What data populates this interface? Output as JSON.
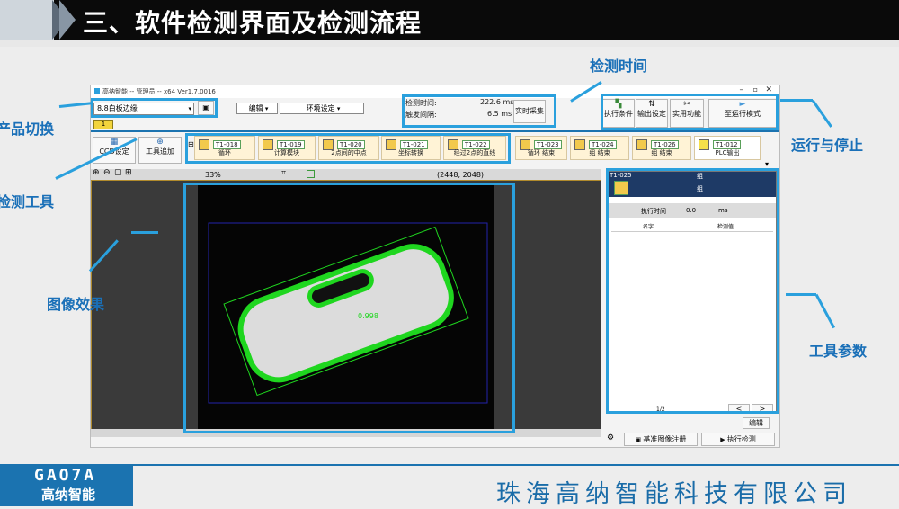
{
  "slide": {
    "title": "三、软件检测界面及检测流程",
    "company": "珠海高纳智能科技有限公司",
    "logo_text": "GAO7A",
    "logo_sub": "高纳智能"
  },
  "annotations": {
    "product_switch": "产品切换",
    "detection_tool": "检测工具",
    "image_effect": "图像效果",
    "detection_time": "检测时间",
    "run_stop": "运行与停止",
    "tool_params": "工具参数"
  },
  "app": {
    "window_title": "高纳智能 -- 管理员 -- x64 Ver1.7.0016",
    "product_select": "8.8白板边缘",
    "tab_number": "1",
    "edit_menu": "编辑",
    "env_menu": "环境设定",
    "detect_time_label": "检测时间:",
    "detect_time_value": "222.6 ms",
    "trigger_interval_label": "触发间隔:",
    "trigger_interval_value": "6.5 ms",
    "realtime_btn": "实时采集",
    "exec_cond_btn": "执行条件",
    "output_btn": "输出设定",
    "utility_btn": "实用功能",
    "run_mode_btn": "至运行模式",
    "ccd_btn": "CCD设定",
    "add_tool_btn": "工具追加",
    "zoom_value": "33%",
    "image_size": "(2448, 2048)",
    "measure_value": "0.998",
    "tools": [
      {
        "id": "T1-018",
        "label": "循环"
      },
      {
        "id": "T1-019",
        "label": "计算模块"
      },
      {
        "id": "T1-020",
        "label": "2点间的中点"
      },
      {
        "id": "T1-021",
        "label": "坐标转换"
      },
      {
        "id": "T1-022",
        "label": "经过2点的直线"
      },
      {
        "id": "T1-023",
        "label": "循环 结束"
      },
      {
        "id": "T1-024",
        "label": "组 结束"
      },
      {
        "id": "T1-026",
        "label": "组 结束"
      },
      {
        "id": "T1-012",
        "label": "PLC输出"
      }
    ],
    "panel": {
      "header_id": "T1-025",
      "header_group": "组",
      "group_label": "组",
      "exec_time_label": "执行时间",
      "exec_time_value": "0.0",
      "exec_time_unit": "ms",
      "col_name": "名字",
      "col_value": "检测值",
      "page": "1/2",
      "prev": "<",
      "next": ">",
      "edit_btn": "编辑",
      "register_btn": "基准图像注册",
      "execute_btn": "执行检测"
    }
  },
  "colors": {
    "accent_blue": "#2aa0dd",
    "header_black": "#0a0a0a",
    "brand_blue": "#1b73b0",
    "detection_green": "#1fd61f"
  }
}
